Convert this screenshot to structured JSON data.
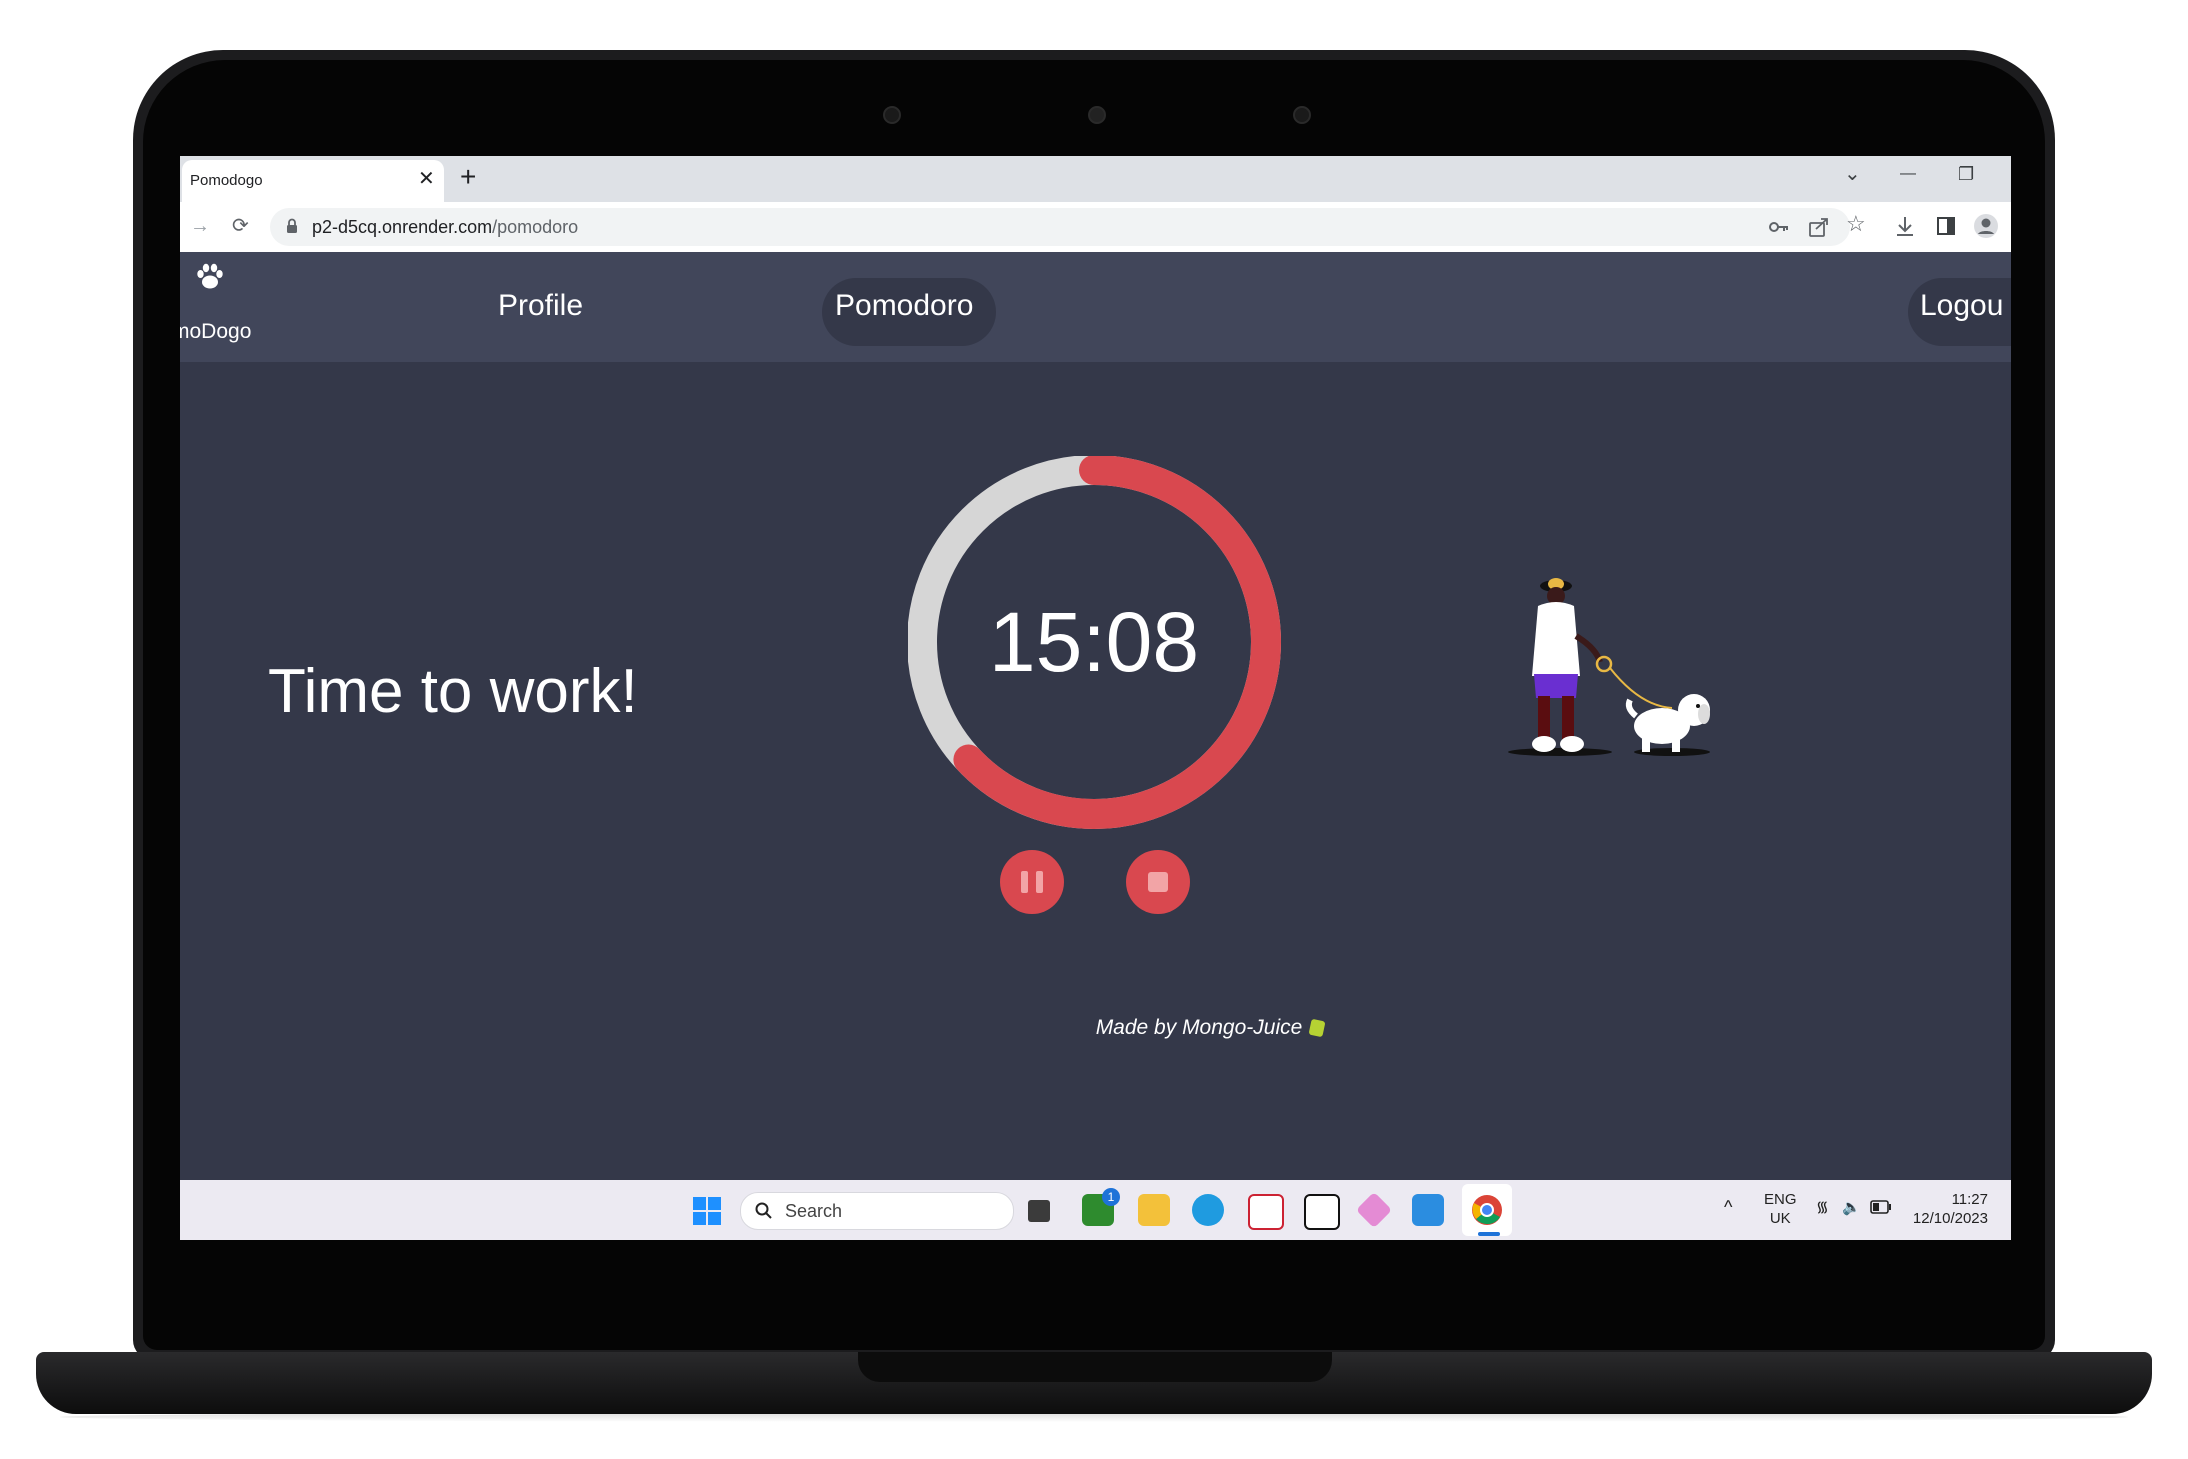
{
  "browser": {
    "tab_title": "Pomodogo",
    "tab_close": "✕",
    "new_tab": "+",
    "window_controls": [
      "⌄",
      "—",
      "❐"
    ],
    "url_domain": "p2-d5cq.onrender.com",
    "url_path": "/pomodoro",
    "toolbar_icons": [
      "key-icon",
      "share-icon",
      "star-icon",
      "download-icon",
      "sidepanel-icon",
      "profile-icon"
    ]
  },
  "navbar": {
    "brand": "moDogo",
    "links": [
      "Profile",
      "Pomodoro",
      "Logou"
    ],
    "active": "Pomodoro"
  },
  "main": {
    "headline": "Time to work!",
    "timer": "15:08",
    "progress_fraction": 0.63,
    "footer_text": "Made by Mongo-Juice"
  },
  "taskbar": {
    "search_label": "Search",
    "badge_count": "1",
    "lang_top": "ENG",
    "lang_bottom": "UK",
    "time": "11:27",
    "date": "12/10/2023"
  },
  "colors": {
    "page_bg": "#343849",
    "navbar_bg": "#41465a",
    "accent_red": "#d9484f",
    "ring_track": "#d6d6d6"
  }
}
